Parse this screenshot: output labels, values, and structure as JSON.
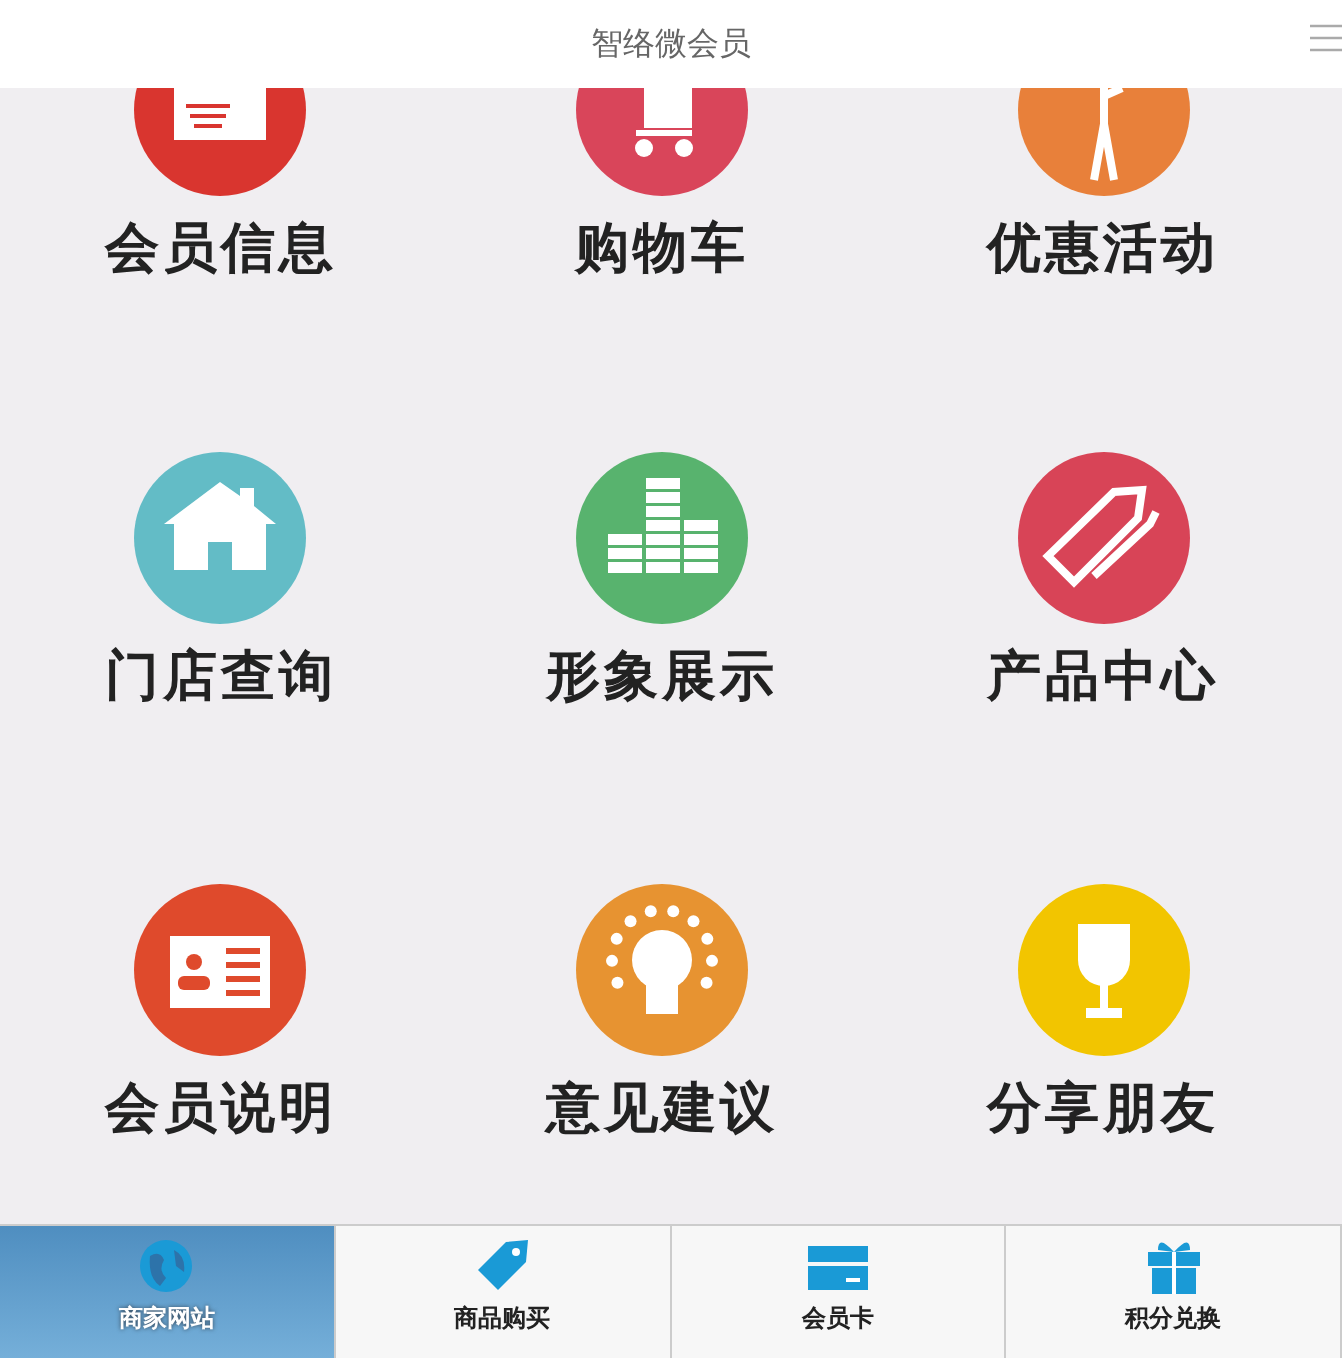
{
  "header": {
    "title": "智络微会员"
  },
  "tiles": [
    {
      "label": "会员信息",
      "color": "#d9352f"
    },
    {
      "label": "购物车",
      "color": "#d9455a"
    },
    {
      "label": "优惠活动",
      "color": "#e8803a"
    },
    {
      "label": "门店查询",
      "color": "#63bcc6"
    },
    {
      "label": "形象展示",
      "color": "#58b36e"
    },
    {
      "label": "产品中心",
      "color": "#d84457"
    },
    {
      "label": "会员说明",
      "color": "#df4a2c"
    },
    {
      "label": "意见建议",
      "color": "#e79331"
    },
    {
      "label": "分享朋友",
      "color": "#f2c500"
    }
  ],
  "tabs": [
    {
      "label": "商家网站",
      "selected": true
    },
    {
      "label": "商品购买",
      "selected": false
    },
    {
      "label": "会员卡",
      "selected": false
    },
    {
      "label": "积分兑换",
      "selected": false
    }
  ]
}
